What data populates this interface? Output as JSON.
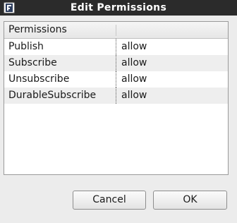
{
  "window": {
    "title": "Edit Permissions",
    "icon": "app-logo-icon"
  },
  "table": {
    "columns": [
      "Permissions",
      ""
    ],
    "rows": [
      [
        "Publish",
        "allow"
      ],
      [
        "Subscribe",
        "allow"
      ],
      [
        "Unsubscribe",
        "allow"
      ],
      [
        "DurableSubscribe",
        "allow"
      ]
    ]
  },
  "buttons": {
    "cancel": "Cancel",
    "ok": "OK"
  }
}
